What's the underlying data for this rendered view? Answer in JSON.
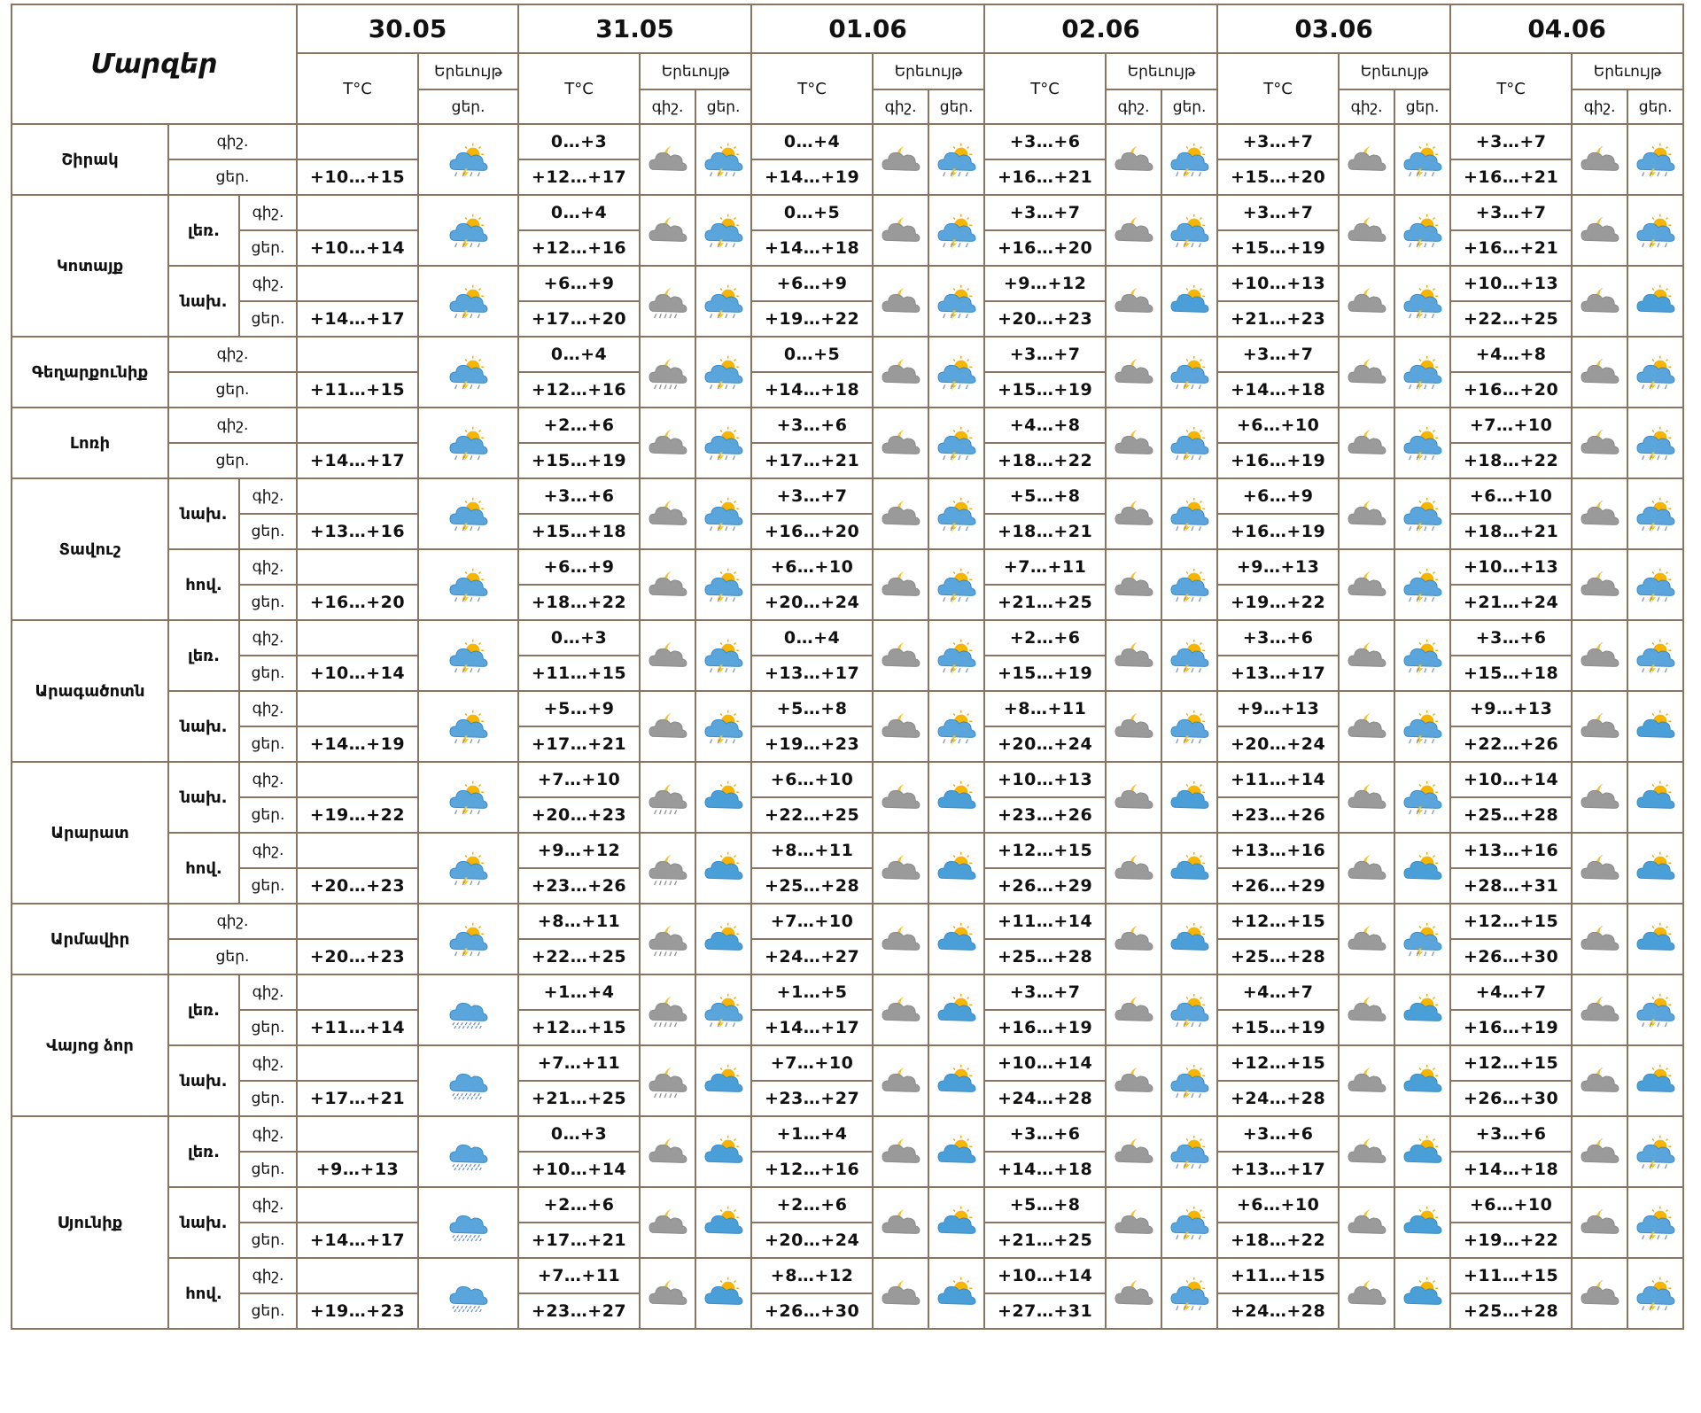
{
  "header": {
    "title": "Մարզեր",
    "temp_label": "T°C",
    "phen_label": "Երեւույթ",
    "night": "գիշ.",
    "day": "ցեր.",
    "dates": [
      "30.05",
      "31.05",
      "01.06",
      "02.06",
      "03.06",
      "04.06"
    ]
  },
  "regions": [
    {
      "name": "Շիրակ",
      "zones": [
        {
          "zone": "",
          "night": [
            "",
            "0…+3",
            "0…+4",
            "+3…+6",
            "+3…+7",
            "+3…+7"
          ],
          "day": [
            "+10…+15",
            "+12…+17",
            "+14…+19",
            "+16…+21",
            "+15…+20",
            "+16…+21"
          ],
          "icons": [
            "storm-sun-icon",
            "cloud-moon-icon",
            "storm-sun-icon",
            "cloud-moon-icon",
            "storm-sun-icon",
            "cloud-moon-icon",
            "storm-sun-icon",
            "cloud-moon-icon",
            "storm-sun-icon",
            "cloud-moon-icon",
            "storm-sun-icon"
          ]
        }
      ]
    },
    {
      "name": "Կոտայք",
      "zones": [
        {
          "zone": "լեռ.",
          "night": [
            "",
            "0…+4",
            "0…+5",
            "+3…+7",
            "+3…+7",
            "+3…+7"
          ],
          "day": [
            "+10…+14",
            "+12…+16",
            "+14…+18",
            "+16…+20",
            "+15…+19",
            "+16…+21"
          ],
          "icons": [
            "storm-sun-icon",
            "cloud-moon-icon",
            "storm-sun-icon",
            "cloud-moon-icon",
            "storm-sun-icon",
            "cloud-moon-icon",
            "storm-sun-icon",
            "cloud-moon-icon",
            "storm-sun-icon",
            "cloud-moon-icon",
            "storm-sun-icon"
          ]
        },
        {
          "zone": "նախ.",
          "night": [
            "",
            "+6…+9",
            "+6…+9",
            "+9…+12",
            "+10…+13",
            "+10…+13"
          ],
          "day": [
            "+14…+17",
            "+17…+20",
            "+19…+22",
            "+20…+23",
            "+21…+23",
            "+22…+25"
          ],
          "icons": [
            "storm-sun-icon",
            "rain-moon-icon",
            "storm-sun-icon",
            "cloud-moon-icon",
            "storm-sun-icon",
            "cloud-moon-icon",
            "partly-cloudy-icon",
            "cloud-moon-icon",
            "storm-sun-icon",
            "cloud-moon-icon",
            "partly-cloudy-icon"
          ]
        }
      ]
    },
    {
      "name": "Գեղարքունիք",
      "zones": [
        {
          "zone": "",
          "night": [
            "",
            "0…+4",
            "0…+5",
            "+3…+7",
            "+3…+7",
            "+4…+8"
          ],
          "day": [
            "+11…+15",
            "+12…+16",
            "+14…+18",
            "+15…+19",
            "+14…+18",
            "+16…+20"
          ],
          "icons": [
            "storm-sun-icon",
            "rain-moon-icon",
            "storm-sun-icon",
            "cloud-moon-icon",
            "storm-sun-icon",
            "cloud-moon-icon",
            "storm-sun-icon",
            "cloud-moon-icon",
            "storm-sun-icon",
            "cloud-moon-icon",
            "storm-sun-icon"
          ]
        }
      ]
    },
    {
      "name": "Լոռի",
      "zones": [
        {
          "zone": "",
          "night": [
            "",
            "+2…+6",
            "+3…+6",
            "+4…+8",
            "+6…+10",
            "+7…+10"
          ],
          "day": [
            "+14…+17",
            "+15…+19",
            "+17…+21",
            "+18…+22",
            "+16…+19",
            "+18…+22"
          ],
          "icons": [
            "storm-sun-icon",
            "cloud-moon-icon",
            "storm-sun-icon",
            "cloud-moon-icon",
            "storm-sun-icon",
            "cloud-moon-icon",
            "storm-sun-icon",
            "cloud-moon-icon",
            "storm-sun-icon",
            "cloud-moon-icon",
            "storm-sun-icon"
          ]
        }
      ]
    },
    {
      "name": "Տավուշ",
      "zones": [
        {
          "zone": "նախ.",
          "night": [
            "",
            "+3…+6",
            "+3…+7",
            "+5…+8",
            "+6…+9",
            "+6…+10"
          ],
          "day": [
            "+13…+16",
            "+15…+18",
            "+16…+20",
            "+18…+21",
            "+16…+19",
            "+18…+21"
          ],
          "icons": [
            "storm-sun-icon",
            "cloud-moon-icon",
            "storm-sun-icon",
            "cloud-moon-icon",
            "storm-sun-icon",
            "cloud-moon-icon",
            "storm-sun-icon",
            "cloud-moon-icon",
            "storm-sun-icon",
            "cloud-moon-icon",
            "storm-sun-icon"
          ]
        },
        {
          "zone": "հով.",
          "night": [
            "",
            "+6…+9",
            "+6…+10",
            "+7…+11",
            "+9…+13",
            "+10…+13"
          ],
          "day": [
            "+16…+20",
            "+18…+22",
            "+20…+24",
            "+21…+25",
            "+19…+22",
            "+21…+24"
          ],
          "icons": [
            "storm-sun-icon",
            "cloud-moon-icon",
            "storm-sun-icon",
            "cloud-moon-icon",
            "storm-sun-icon",
            "cloud-moon-icon",
            "storm-sun-icon",
            "cloud-moon-icon",
            "storm-sun-icon",
            "cloud-moon-icon",
            "storm-sun-icon"
          ]
        }
      ]
    },
    {
      "name": "Արագածոտն",
      "zones": [
        {
          "zone": "լեռ.",
          "night": [
            "",
            "0…+3",
            "0…+4",
            "+2…+6",
            "+3…+6",
            "+3…+6"
          ],
          "day": [
            "+10…+14",
            "+11…+15",
            "+13…+17",
            "+15…+19",
            "+13…+17",
            "+15…+18"
          ],
          "icons": [
            "storm-sun-icon",
            "cloud-moon-icon",
            "storm-sun-icon",
            "cloud-moon-icon",
            "storm-sun-icon",
            "cloud-moon-icon",
            "storm-sun-icon",
            "cloud-moon-icon",
            "storm-sun-icon",
            "cloud-moon-icon",
            "storm-sun-icon"
          ]
        },
        {
          "zone": "նախ.",
          "night": [
            "",
            "+5…+9",
            "+5…+8",
            "+8…+11",
            "+9…+13",
            "+9…+13"
          ],
          "day": [
            "+14…+19",
            "+17…+21",
            "+19…+23",
            "+20…+24",
            "+20…+24",
            "+22…+26"
          ],
          "icons": [
            "storm-sun-icon",
            "cloud-moon-icon",
            "storm-sun-icon",
            "cloud-moon-icon",
            "storm-sun-icon",
            "cloud-moon-icon",
            "storm-sun-icon",
            "cloud-moon-icon",
            "storm-sun-icon",
            "cloud-moon-icon",
            "partly-cloudy-icon"
          ]
        }
      ]
    },
    {
      "name": "Արարատ",
      "zones": [
        {
          "zone": "նախ.",
          "night": [
            "",
            "+7…+10",
            "+6…+10",
            "+10…+13",
            "+11…+14",
            "+10…+14"
          ],
          "day": [
            "+19…+22",
            "+20…+23",
            "+22…+25",
            "+23…+26",
            "+23…+26",
            "+25…+28"
          ],
          "icons": [
            "storm-sun-icon",
            "rain-moon-icon",
            "partly-cloudy-icon",
            "cloud-moon-icon",
            "partly-cloudy-icon",
            "cloud-moon-icon",
            "partly-cloudy-icon",
            "cloud-moon-icon",
            "storm-sun-icon",
            "cloud-moon-icon",
            "partly-cloudy-icon"
          ]
        },
        {
          "zone": "հով.",
          "night": [
            "",
            "+9…+12",
            "+8…+11",
            "+12…+15",
            "+13…+16",
            "+13…+16"
          ],
          "day": [
            "+20…+23",
            "+23…+26",
            "+25…+28",
            "+26…+29",
            "+26…+29",
            "+28…+31"
          ],
          "icons": [
            "storm-sun-icon",
            "rain-moon-icon",
            "partly-cloudy-icon",
            "cloud-moon-icon",
            "partly-cloudy-icon",
            "cloud-moon-icon",
            "partly-cloudy-icon",
            "cloud-moon-icon",
            "partly-cloudy-icon",
            "cloud-moon-icon",
            "partly-cloudy-icon"
          ]
        }
      ]
    },
    {
      "name": "Արմավիր",
      "zones": [
        {
          "zone": "",
          "night": [
            "",
            "+8…+11",
            "+7…+10",
            "+11…+14",
            "+12…+15",
            "+12…+15"
          ],
          "day": [
            "+20…+23",
            "+22…+25",
            "+24…+27",
            "+25…+28",
            "+25…+28",
            "+26…+30"
          ],
          "icons": [
            "storm-sun-icon",
            "rain-moon-icon",
            "partly-cloudy-icon",
            "cloud-moon-icon",
            "partly-cloudy-icon",
            "cloud-moon-icon",
            "partly-cloudy-icon",
            "cloud-moon-icon",
            "storm-sun-icon",
            "cloud-moon-icon",
            "partly-cloudy-icon"
          ]
        }
      ]
    },
    {
      "name": "Վայոց ձոր",
      "zones": [
        {
          "zone": "լեռ.",
          "night": [
            "",
            "+1…+4",
            "+1…+5",
            "+3…+7",
            "+4…+7",
            "+4…+7"
          ],
          "day": [
            "+11…+14",
            "+12…+15",
            "+14…+17",
            "+16…+19",
            "+15…+19",
            "+16…+19"
          ],
          "icons": [
            "rain-cloud-icon",
            "rain-moon-icon",
            "storm-sun-icon",
            "cloud-moon-icon",
            "partly-cloudy-icon",
            "cloud-moon-icon",
            "storm-sun-icon",
            "cloud-moon-icon",
            "partly-cloudy-icon",
            "cloud-moon-icon",
            "storm-sun-icon"
          ]
        },
        {
          "zone": "նախ.",
          "night": [
            "",
            "+7…+11",
            "+7…+10",
            "+10…+14",
            "+12…+15",
            "+12…+15"
          ],
          "day": [
            "+17…+21",
            "+21…+25",
            "+23…+27",
            "+24…+28",
            "+24…+28",
            "+26…+30"
          ],
          "icons": [
            "rain-cloud-icon",
            "rain-moon-icon",
            "partly-cloudy-icon",
            "cloud-moon-icon",
            "partly-cloudy-icon",
            "cloud-moon-icon",
            "storm-sun-icon",
            "cloud-moon-icon",
            "partly-cloudy-icon",
            "cloud-moon-icon",
            "partly-cloudy-icon"
          ]
        }
      ]
    },
    {
      "name": "Սյունիք",
      "zones": [
        {
          "zone": "լեռ.",
          "night": [
            "",
            "0…+3",
            "+1…+4",
            "+3…+6",
            "+3…+6",
            "+3…+6"
          ],
          "day": [
            "+9…+13",
            "+10…+14",
            "+12…+16",
            "+14…+18",
            "+13…+17",
            "+14…+18"
          ],
          "icons": [
            "rain-cloud-icon",
            "cloud-moon-icon",
            "partly-cloudy-icon",
            "cloud-moon-icon",
            "partly-cloudy-icon",
            "cloud-moon-icon",
            "storm-sun-icon",
            "cloud-moon-icon",
            "partly-cloudy-icon",
            "cloud-moon-icon",
            "storm-sun-icon"
          ]
        },
        {
          "zone": "նախ.",
          "night": [
            "",
            "+2…+6",
            "+2…+6",
            "+5…+8",
            "+6…+10",
            "+6…+10"
          ],
          "day": [
            "+14…+17",
            "+17…+21",
            "+20…+24",
            "+21…+25",
            "+18…+22",
            "+19…+22"
          ],
          "icons": [
            "rain-cloud-icon",
            "cloud-moon-icon",
            "partly-cloudy-icon",
            "cloud-moon-icon",
            "partly-cloudy-icon",
            "cloud-moon-icon",
            "storm-sun-icon",
            "cloud-moon-icon",
            "partly-cloudy-icon",
            "cloud-moon-icon",
            "storm-sun-icon"
          ]
        },
        {
          "zone": "հով.",
          "night": [
            "",
            "+7…+11",
            "+8…+12",
            "+10…+14",
            "+11…+15",
            "+11…+15"
          ],
          "day": [
            "+19…+23",
            "+23…+27",
            "+26…+30",
            "+27…+31",
            "+24…+28",
            "+25…+28"
          ],
          "icons": [
            "rain-cloud-icon",
            "cloud-moon-icon",
            "partly-cloudy-icon",
            "cloud-moon-icon",
            "partly-cloudy-icon",
            "cloud-moon-icon",
            "storm-sun-icon",
            "cloud-moon-icon",
            "partly-cloudy-icon",
            "cloud-moon-icon",
            "storm-sun-icon"
          ]
        }
      ]
    }
  ]
}
